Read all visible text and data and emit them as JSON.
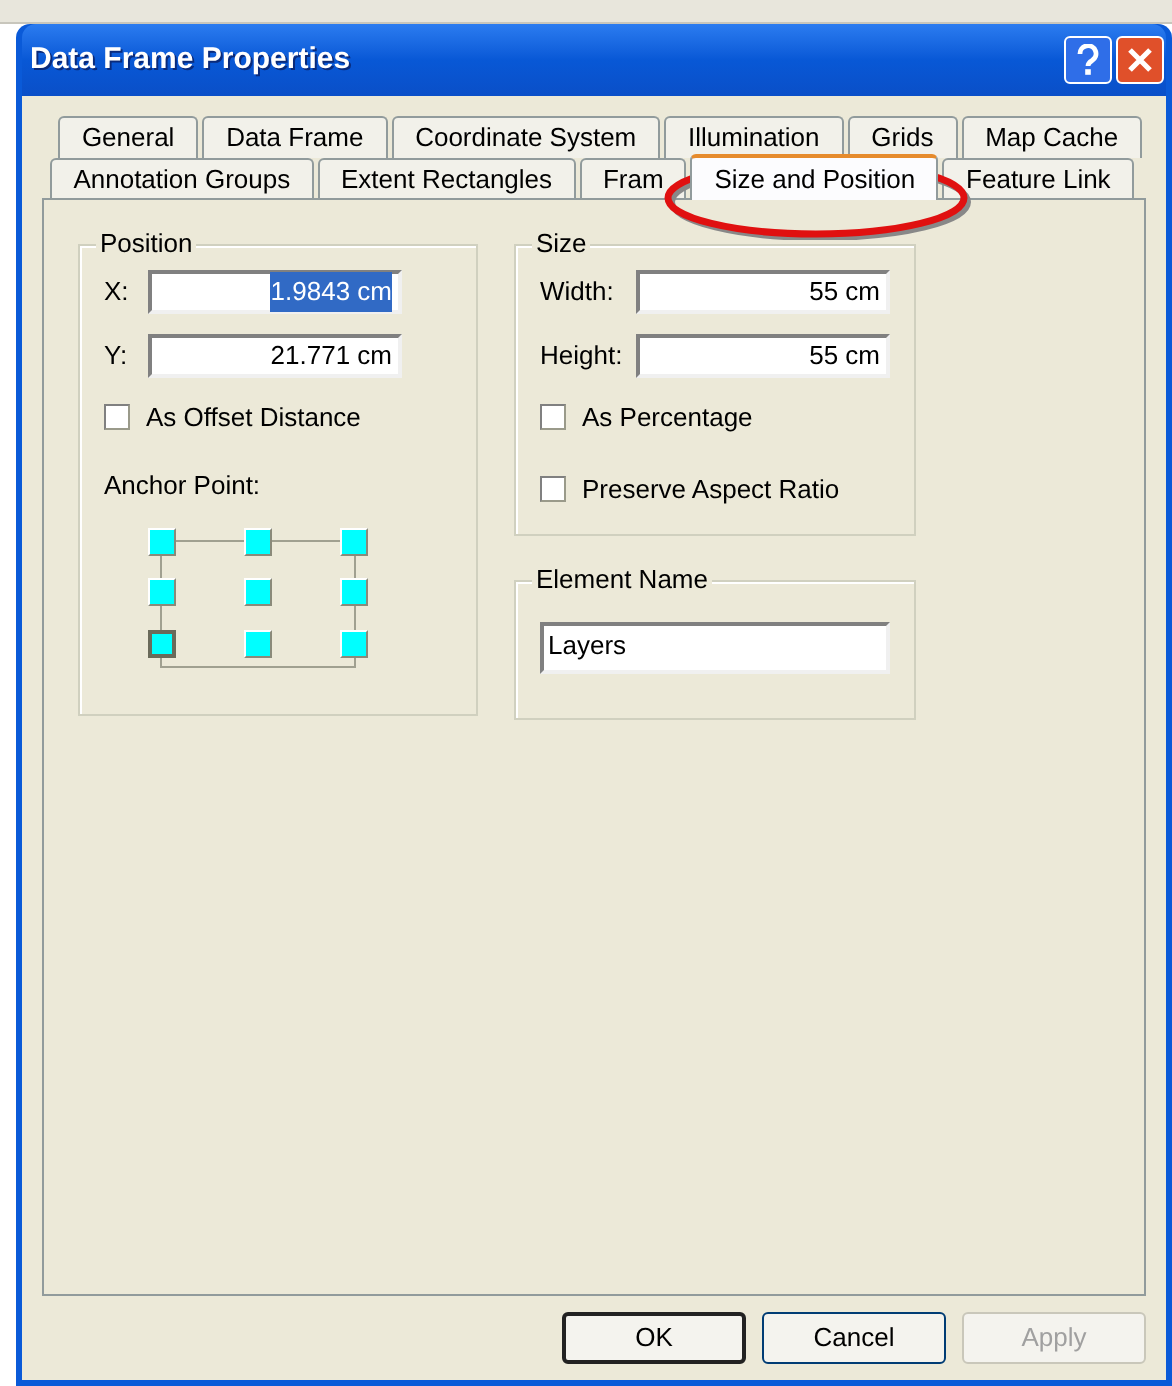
{
  "window": {
    "title": "Data Frame Properties"
  },
  "tab_rows": [
    [
      {
        "label": "General",
        "selected": false
      },
      {
        "label": "Data Frame",
        "selected": false
      },
      {
        "label": "Coordinate System",
        "selected": false
      },
      {
        "label": "Illumination",
        "selected": false
      },
      {
        "label": "Grids",
        "selected": false
      },
      {
        "label": "Map Cache",
        "selected": false
      }
    ],
    [
      {
        "label": "Annotation Groups",
        "selected": false
      },
      {
        "label": "Extent Rectangles",
        "selected": false
      },
      {
        "label": "Fram",
        "selected": false
      },
      {
        "label": "Size and Position",
        "selected": true
      },
      {
        "label": "Feature Link",
        "selected": false
      }
    ]
  ],
  "position": {
    "title": "Position",
    "fields": [
      {
        "label": "X:",
        "value": "1.9843 cm",
        "selected": true
      },
      {
        "label": "Y:",
        "value": "21.771 cm",
        "selected": false
      }
    ],
    "offset": {
      "label": "As Offset Distance",
      "checked": false
    },
    "anchor_label": "Anchor Point:",
    "anchor_points": [
      {
        "selected": false
      },
      {
        "selected": false
      },
      {
        "selected": false
      },
      {
        "selected": false
      },
      {
        "selected": false
      },
      {
        "selected": false
      },
      {
        "selected": true
      },
      {
        "selected": false
      },
      {
        "selected": false
      }
    ]
  },
  "size": {
    "title": "Size",
    "fields": [
      {
        "label": "Width:",
        "value": "55 cm"
      },
      {
        "label": "Height:",
        "value": "55 cm"
      }
    ],
    "options": [
      {
        "label": "As Percentage",
        "checked": false
      },
      {
        "label": "Preserve Aspect Ratio",
        "checked": false
      }
    ]
  },
  "element_name": {
    "title": "Element Name",
    "value": "Layers"
  },
  "buttons": [
    {
      "label": "OK",
      "default": true,
      "disabled": false
    },
    {
      "label": "Cancel",
      "default": false,
      "disabled": false
    },
    {
      "label": "Apply",
      "default": false,
      "disabled": true
    }
  ]
}
